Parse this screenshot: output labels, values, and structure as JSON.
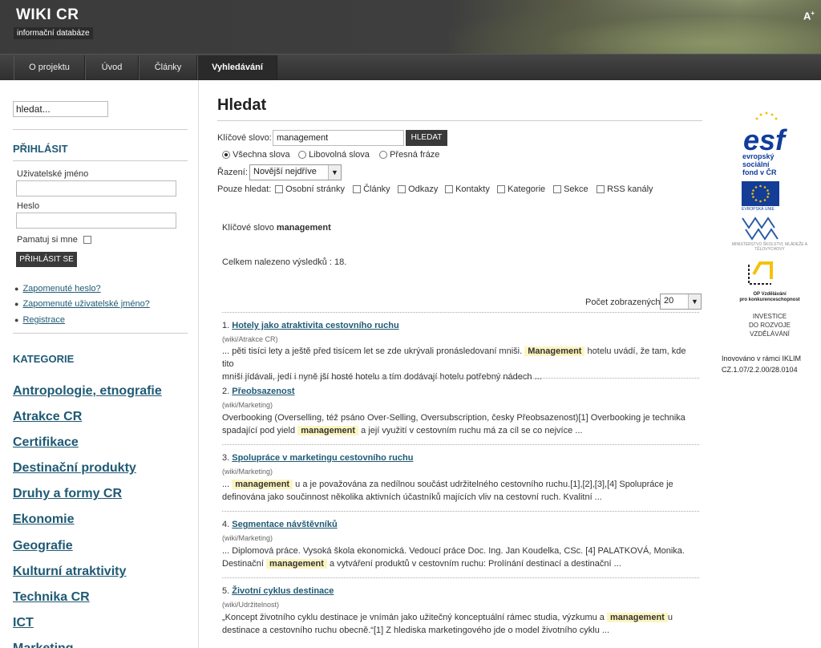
{
  "header": {
    "site_title": "WIKI CR",
    "site_subtitle": "informační databáze",
    "font_size_label": "A",
    "font_size_sup": "+"
  },
  "nav": {
    "tabs": [
      {
        "label": "O projektu"
      },
      {
        "label": "Úvod"
      },
      {
        "label": "Články"
      },
      {
        "label": "Vyhledávání"
      }
    ]
  },
  "sidebar": {
    "search_placeholder": "hledat...",
    "login_heading": "PŘIHLÁSIT",
    "username_label": "Uživatelské jméno",
    "password_label": "Heslo",
    "remember_label": "Pamatuj si mne",
    "login_button": "PŘIHLÁSIT SE",
    "links": [
      {
        "label": "Zapomenuté heslo?"
      },
      {
        "label": "Zapomenuté uživatelské jméno?"
      },
      {
        "label": "Registrace"
      }
    ],
    "category_heading": "KATEGORIE",
    "categories": [
      {
        "label": "Antropologie, etnografie"
      },
      {
        "label": "Atrakce CR"
      },
      {
        "label": "Certifikace"
      },
      {
        "label": "Destinační produkty"
      },
      {
        "label": "Druhy a formy CR"
      },
      {
        "label": "Ekonomie"
      },
      {
        "label": "Geografie"
      },
      {
        "label": "Kulturní atraktivity"
      },
      {
        "label": "Technika CR"
      },
      {
        "label": "ICT"
      },
      {
        "label": "Marketing"
      }
    ]
  },
  "main": {
    "title": "Hledat",
    "keyword_label": "Klíčové slovo:",
    "keyword_value": "management",
    "search_button": "HLEDAT",
    "radio_options": [
      {
        "label": "Všechna slova",
        "checked": true
      },
      {
        "label": "Libovolná slova",
        "checked": false
      },
      {
        "label": "Přesná fráze",
        "checked": false
      }
    ],
    "sort_label": "Řazení:",
    "sort_value": "Novější nejdříve",
    "only_search_label": "Pouze hledat:",
    "only_options": [
      {
        "label": "Osobní stránky"
      },
      {
        "label": "Články"
      },
      {
        "label": "Odkazy"
      },
      {
        "label": "Kontakty"
      },
      {
        "label": "Kategorie"
      },
      {
        "label": "Sekce"
      },
      {
        "label": "RSS kanály"
      }
    ],
    "keyword_summary_prefix": "Klíčové slovo",
    "keyword_summary_value": "management",
    "total_results": "Celkem nalezeno výsledků : 18.",
    "per_page_label": "Počet zobrazených",
    "per_page_value": "20",
    "results": [
      {
        "number": "1.",
        "title": "Hotely jako atraktivita cestovního ruchu",
        "path": "(wiki/Atrakce CR)",
        "line1_before": "... pěti tisíci lety a ještě před tisícem let se zde ukrývali pronásledovaní mniši.",
        "line1_highlight": "Management",
        "line1_after": "hotelu uvádí, že tam, kde tito",
        "line2_before": "mniši jídávali, jedí i nyně jší hosté hotelu a tím dodávají hotelu potřebný nádech ...",
        "line2_highlight": "",
        "line2_after": ""
      },
      {
        "number": "2.",
        "title": "Přeobsazenost",
        "path": "(wiki/Marketing)",
        "line1_before": "Overbooking (Overselling, též psáno Over-Selling, Oversubscription, česky Přeobsazenost)[1] Overbooking je technika",
        "line1_highlight": "",
        "line1_after": "",
        "line2_before": "spadající pod yield",
        "line2_highlight": "management",
        "line2_after": "a její využití v cestovním ruchu má za cíl se co nejvíce ..."
      },
      {
        "number": "3.",
        "title": "Spolupráce v marketingu cestovního ruchu",
        "path": "(wiki/Marketing)",
        "line1_before": "...",
        "line1_highlight": "management",
        "line1_after": "u a je považována za nedílnou součást udržitelného cestovního ruchu.[1],[2],[3],[4] Spolupráce je",
        "line2_before": "definována jako součinnost několika aktivních účastníků majících vliv na cestovní ruch. Kvalitní ...",
        "line2_highlight": "",
        "line2_after": ""
      },
      {
        "number": "4.",
        "title": "Segmentace návštěvníků",
        "path": "(wiki/Marketing)",
        "line1_before": "... Diplomová práce. Vysoká škola ekonomická. Vedoucí práce Doc. Ing. Jan Koudelka, CSc.   [4] PALATKOVÁ, Monika.",
        "line1_highlight": "",
        "line1_after": "",
        "line2_before": "Destinační",
        "line2_highlight": "management",
        "line2_after": "a vytváření produktů v cestovním ruchu: Prolínání destinací a destinační ..."
      },
      {
        "number": "5.",
        "title": "Životní cyklus destinace",
        "path": "(wiki/Udržitelnost)",
        "line1_before": "„Koncept životního cyklu destinace je vnímán jako užitečný konceptuální rámec studia, výzkumu a",
        "line1_highlight": "management",
        "line1_after": "u",
        "line2_before": "destinace a cestovního ruchu obecně.“[1] Z hlediska marketingového jde o model životního cyklu ...",
        "line2_highlight": "",
        "line2_after": ""
      }
    ]
  },
  "right": {
    "esf_lines": [
      "evropský",
      "sociální",
      "fond v ČR"
    ],
    "eu_label": "EVROPSKÁ UNIE",
    "msmt_label": "MINISTERSTVO ŠKOLSTVÍ, MLÁDEŽE A TĚLOVÝCHOVY",
    "op_lines": [
      "OP Vzdělávání",
      "pro konkurenceschopnost"
    ],
    "invest_lines": [
      "INVESTICE",
      "DO ROZVOJE",
      "VZDĚLÁVÁNÍ"
    ],
    "iklim_line1": "Inovováno v rámci IKLIM",
    "iklim_line2": "CZ.1.07/2.2.00/28.0104"
  },
  "colors": {
    "link": "#1f5a74",
    "highlight": "#fdf5c0",
    "header_bg": "#3b3b3b",
    "esf_blue": "#103c9c"
  }
}
